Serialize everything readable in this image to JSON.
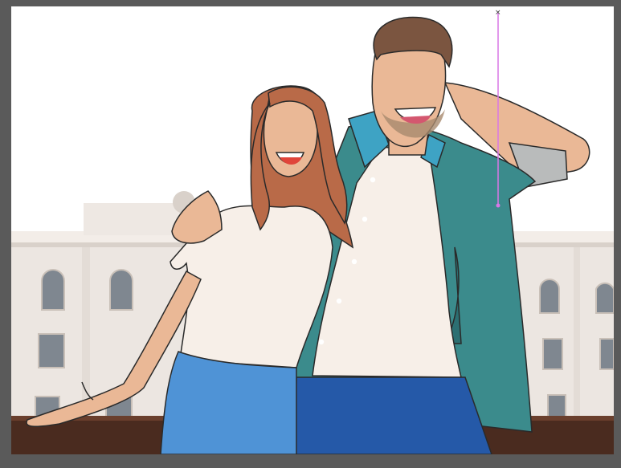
{
  "app": {
    "background_color": "#5a5a5a",
    "canvas_color": "#ffffff"
  },
  "artwork": {
    "subject": "illustration-couple-laughing",
    "colors": {
      "sky": "#ffffff",
      "building": "#ece6e1",
      "building_shadow": "#d9d1ca",
      "window": "#7f8790",
      "railing": "#4a2b1f",
      "skin": "#eab896",
      "hair_woman": "#b96a48",
      "hair_man": "#7b5540",
      "tshirt": "#f7efe8",
      "jacket": "#3b8b8c",
      "jacket_dark": "#2c6f72",
      "collar": "#3ea3c4",
      "jeans_woman": "#4f93d6",
      "jeans_man": "#2559a8",
      "guide_line": "#d977e6"
    }
  }
}
